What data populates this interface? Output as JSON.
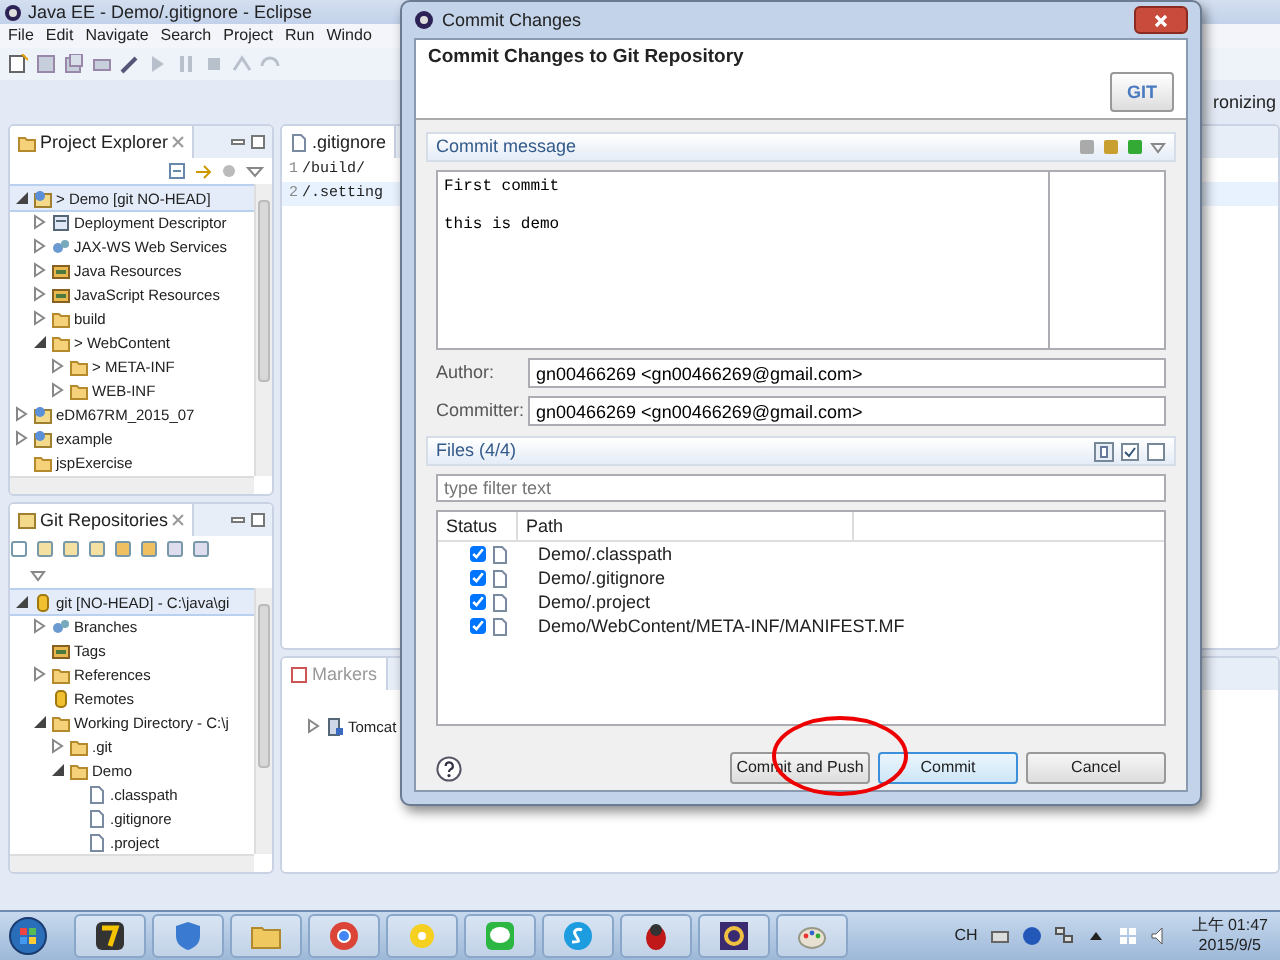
{
  "window": {
    "title": "Java EE - Demo/.gitignore - Eclipse"
  },
  "menu": [
    "File",
    "Edit",
    "Navigate",
    "Search",
    "Project",
    "Run",
    "Windo"
  ],
  "perspective": {
    "label": "ronizing"
  },
  "project_explorer": {
    "title": "Project Explorer",
    "tree": [
      {
        "label": "> Demo  [git NO-HEAD]",
        "kind": "project",
        "expanded": true,
        "selected": true,
        "children": [
          {
            "label": "Deployment Descriptor",
            "kind": "descriptor",
            "expanded": false,
            "selected": false
          },
          {
            "label": "JAX-WS Web Services",
            "kind": "service",
            "expanded": false,
            "selected": false
          },
          {
            "label": "Java Resources",
            "kind": "library",
            "expanded": false,
            "selected": false
          },
          {
            "label": "JavaScript Resources",
            "kind": "library",
            "expanded": false,
            "selected": false
          },
          {
            "label": "build",
            "kind": "folder",
            "expanded": false,
            "selected": false
          },
          {
            "label": "> WebContent",
            "kind": "folder",
            "expanded": true,
            "selected": false,
            "children": [
              {
                "label": "> META-INF",
                "kind": "folder",
                "expanded": false,
                "selected": false
              },
              {
                "label": "WEB-INF",
                "kind": "folder",
                "expanded": false,
                "selected": false
              }
            ]
          }
        ]
      },
      {
        "label": "eDM67RM_2015_07",
        "kind": "project",
        "expanded": false,
        "selected": false
      },
      {
        "label": "example",
        "kind": "project",
        "expanded": false,
        "selected": false
      },
      {
        "label": "jspExercise",
        "kind": "folder",
        "selected": false
      }
    ]
  },
  "git_repositories": {
    "title": "Git Repositories",
    "tree": [
      {
        "label": "git [NO-HEAD] - C:\\java\\gi",
        "kind": "repository",
        "expanded": true,
        "selected": true,
        "children": [
          {
            "label": "Branches",
            "kind": "service",
            "expanded": false,
            "selected": false
          },
          {
            "label": "Tags",
            "kind": "library",
            "selected": false
          },
          {
            "label": "References",
            "kind": "folder",
            "expanded": false,
            "selected": false
          },
          {
            "label": "Remotes",
            "kind": "repository",
            "selected": false
          },
          {
            "label": "Working Directory - C:\\j",
            "kind": "folder",
            "expanded": true,
            "selected": false,
            "children": [
              {
                "label": ".git",
                "kind": "folder",
                "expanded": false,
                "selected": false
              },
              {
                "label": "Demo",
                "kind": "folder",
                "expanded": true,
                "selected": false,
                "children": [
                  {
                    "label": ".classpath",
                    "kind": "file",
                    "selected": false
                  },
                  {
                    "label": ".gitignore",
                    "kind": "file",
                    "selected": false
                  },
                  {
                    "label": ".project",
                    "kind": "file",
                    "selected": false
                  }
                ]
              }
            ]
          }
        ]
      }
    ]
  },
  "editor": {
    "tab": ".gitignore",
    "lines": [
      {
        "number": "1",
        "text": "/build/",
        "current": false
      },
      {
        "number": "2",
        "text": "/.setting",
        "current": true
      }
    ]
  },
  "markers": {
    "tab": "Markers",
    "tree": [
      {
        "label": "Tomcat",
        "kind": "server",
        "expanded": false,
        "selected": false
      }
    ]
  },
  "dialog": {
    "title": "Commit Changes",
    "heading": "Commit Changes to Git Repository",
    "logo": "GIT",
    "message_section": "Commit message",
    "message": "First commit\n\nthis is demo",
    "author_label": "Author:",
    "author": "gn00466269 <gn00466269@gmail.com>",
    "committer_label": "Committer:",
    "committer": "gn00466269 <gn00466269@gmail.com>",
    "files_section": "Files (4/4)",
    "filter": {
      "placeholder": "type filter text"
    },
    "columns": [
      "Status",
      "Path"
    ],
    "rows": [
      {
        "checked": true,
        "path": "Demo/.classpath"
      },
      {
        "checked": true,
        "path": "Demo/.gitignore"
      },
      {
        "checked": true,
        "path": "Demo/.project"
      },
      {
        "checked": true,
        "path": "Demo/WebContent/META-INF/MANIFEST.MF"
      }
    ],
    "buttons": [
      {
        "label": "Commit and Push",
        "default": false
      },
      {
        "label": "Commit",
        "default": true
      },
      {
        "label": "Cancel",
        "default": false
      }
    ]
  },
  "taskbar": {
    "language": "CH",
    "time": "上午 01:47",
    "date": "2015/9/5"
  }
}
